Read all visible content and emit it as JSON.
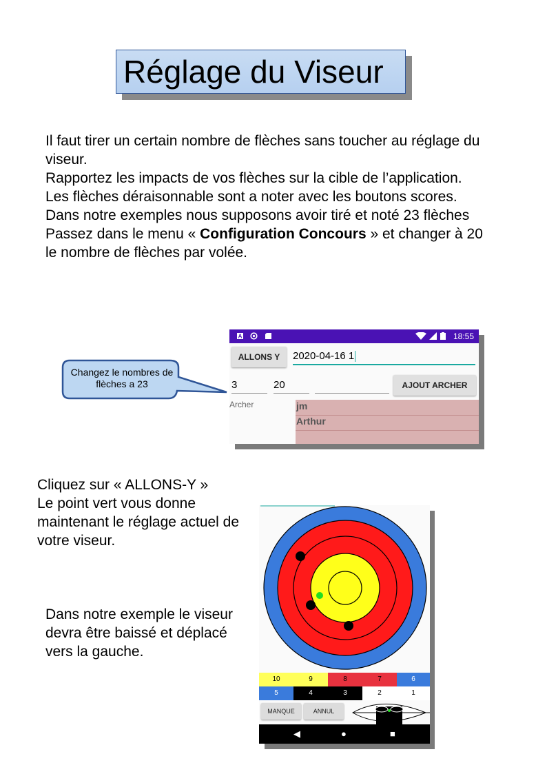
{
  "title": "Réglage du Viseur",
  "intro": {
    "p1": "Il faut tirer un certain nombre de flèches sans toucher au réglage du viseur.",
    "p2": "Rapportez les impacts de vos flèches sur la cible de l’application. Les flèches déraisonnable sont a noter avec les boutons scores.",
    "p3": "Dans notre exemples nous supposons avoir tiré et noté 23 flèches",
    "p4_before": "Passez dans le menu « ",
    "p4_bold": "Configuration Concours",
    "p4_after": " » et changer à 20 le nombre de flèches par volée."
  },
  "callout": {
    "text": "Changez le nombres de flèches a 23"
  },
  "app_config": {
    "status_time": "18:55",
    "allons_label": "ALLONS Y",
    "date_value": "2020-04-16 1",
    "field_arrows": "3",
    "field_per_volley": "20",
    "field_extra": "",
    "ajout_label": "AJOUT ARCHER",
    "archer_label": "Archer",
    "archers": [
      "jm",
      "Arthur"
    ]
  },
  "mid_text": {
    "l1": "Cliquez sur « ALLONS-Y »",
    "l2": "Le point vert vous donne maintenant le réglage actuel de votre viseur."
  },
  "example_text": "Dans notre exemple le viseur devra être baissé et déplacé vers la gauche.",
  "app_target": {
    "score_row1": [
      "10",
      "9",
      "8",
      "7",
      "6"
    ],
    "score_row2": [
      "5",
      "4",
      "3",
      "2",
      "1"
    ],
    "manque_label": "MANQUE",
    "annul_label": "ANNUL",
    "nav": {
      "back": "◀",
      "home": "●",
      "recent": "■"
    }
  },
  "colors": {
    "ring_blue": "#3a7bdc",
    "ring_red": "#ff1a1a",
    "ring_yellow": "#ffff1a",
    "sight_point": "#22dd22",
    "status_bar": "#4a12b4",
    "archer_panel": "#d9b1b1"
  }
}
